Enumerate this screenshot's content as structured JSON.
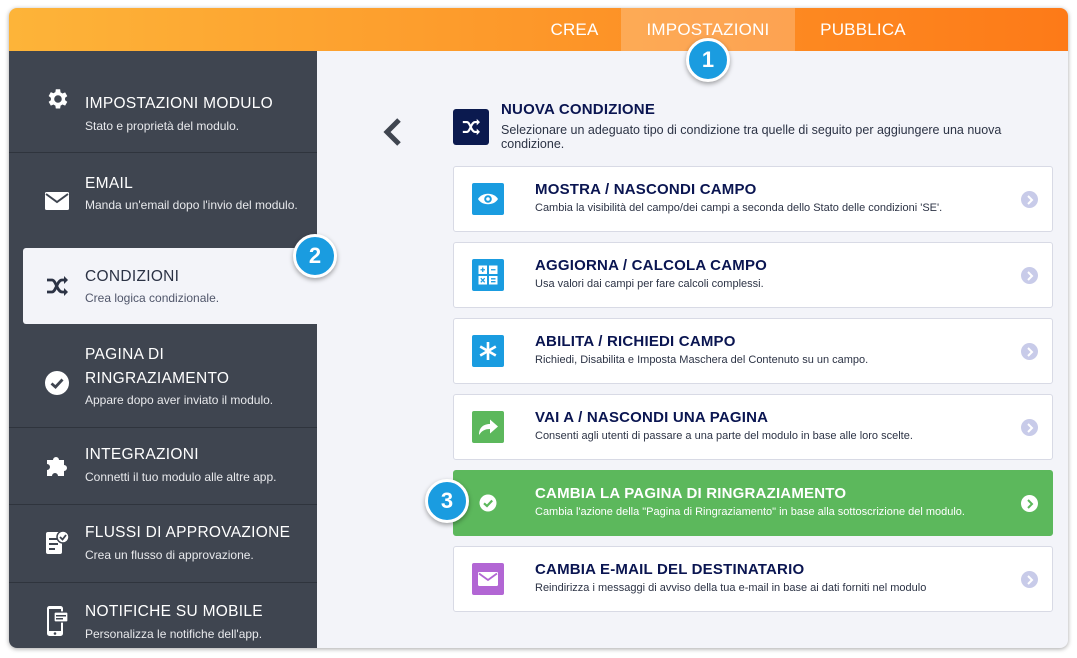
{
  "topbar": {
    "tabs": [
      {
        "label": "CREA"
      },
      {
        "label": "IMPOSTAZIONI"
      },
      {
        "label": "PUBBLICA"
      }
    ]
  },
  "sidebar": {
    "items": [
      {
        "title": "IMPOSTAZIONI MODULO",
        "desc": "Stato e proprietà del modulo.",
        "icon": "gear-icon"
      },
      {
        "title": "EMAIL",
        "desc": "Manda un'email dopo l'invio del modulo.",
        "icon": "envelope-icon"
      },
      {
        "title": "CONDIZIONI",
        "desc": "Crea logica condizionale.",
        "icon": "shuffle-icon"
      },
      {
        "title": "PAGINA DI RINGRAZIAMENTO",
        "desc": "Appare dopo aver inviato il modulo.",
        "icon": "check-circle-icon"
      },
      {
        "title": "INTEGRAZIONI",
        "desc": "Connetti il tuo modulo alle altre app.",
        "icon": "puzzle-icon"
      },
      {
        "title": "FLUSSI DI APPROVAZIONE",
        "desc": "Crea un flusso di approvazione.",
        "icon": "approval-icon"
      },
      {
        "title": "NOTIFICHE SU MOBILE",
        "desc": "Personalizza le notifiche dell'app.",
        "icon": "mobile-icon"
      }
    ]
  },
  "main": {
    "title": "NUOVA CONDIZIONE",
    "subtitle": "Selezionare un adeguato tipo di condizione tra quelle di seguito per aggiungere una nuova condizione.",
    "cards": [
      {
        "title": "MOSTRA / NASCONDI CAMPO",
        "desc": "Cambia la visibilità del campo/dei campi a seconda dello Stato delle condizioni 'SE'.",
        "icon": "eye-icon",
        "color": "#1a9ce0"
      },
      {
        "title": "AGGIORNA / CALCOLA CAMPO",
        "desc": "Usa valori dai campi per fare calcoli complessi.",
        "icon": "calculator-icon",
        "color": "#1a9ce0"
      },
      {
        "title": "ABILITA / RICHIEDI CAMPO",
        "desc": "Richiedi, Disabilita e Imposta Maschera del Contenuto su un campo.",
        "icon": "asterisk-icon",
        "color": "#1a9ce0"
      },
      {
        "title": "VAI A / NASCONDI UNA PAGINA",
        "desc": "Consenti agli utenti di passare a una parte del modulo in base alle loro scelte.",
        "icon": "share-arrow-icon",
        "color": "#5cb85c"
      },
      {
        "title": "CAMBIA LA PAGINA DI RINGRAZIAMENTO",
        "desc": "Cambia l'azione della \"Pagina di Ringraziamento\" in base alla sottoscrizione del modulo.",
        "icon": "check-circle-icon",
        "color": "#5cb85c"
      },
      {
        "title": "CAMBIA E-MAIL DEL DESTINATARIO",
        "desc": "Reindirizza i messaggi di avviso della tua e-mail in base ai dati forniti nel modulo",
        "icon": "envelope-icon",
        "color": "#b266d4"
      }
    ]
  },
  "badges": [
    "1",
    "2",
    "3"
  ]
}
